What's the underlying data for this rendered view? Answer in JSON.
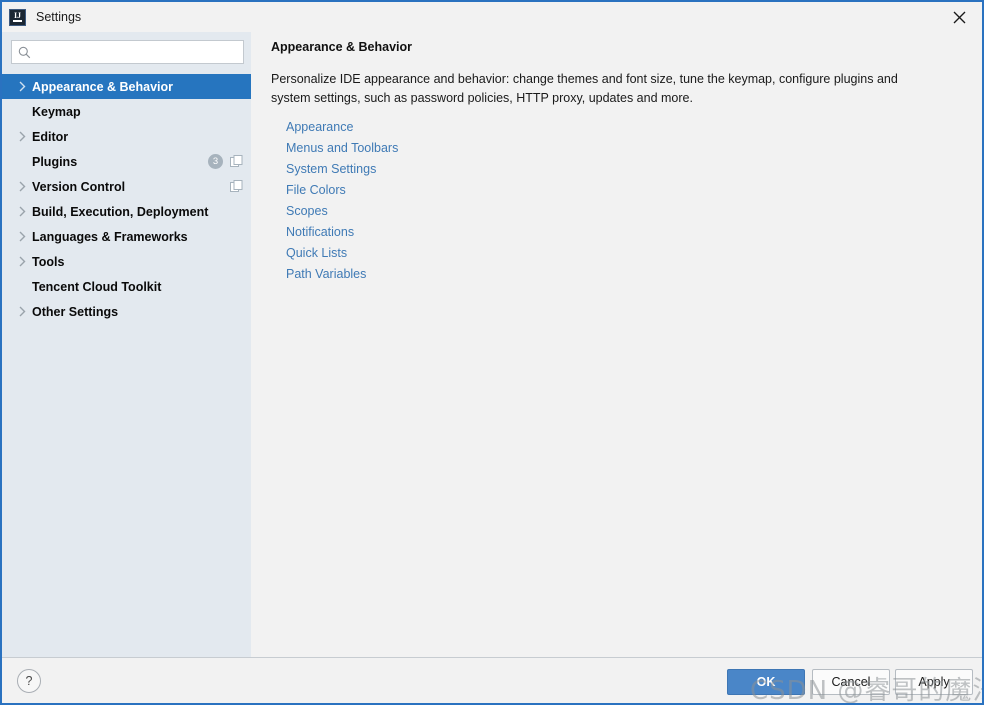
{
  "window": {
    "title": "Settings",
    "logo_icon": "intellij-idea-logo",
    "close_icon": "close-icon",
    "border_color": "#2a72c0"
  },
  "search": {
    "value": "",
    "placeholder": "",
    "icon": "search-icon"
  },
  "sidebar": {
    "background": "#e3e9ef",
    "selected_color": "#2675bf",
    "items": [
      {
        "label": "Appearance & Behavior",
        "expandable": true,
        "selected": true,
        "badge": null,
        "stack_icon": false
      },
      {
        "label": "Keymap",
        "expandable": false,
        "selected": false,
        "badge": null,
        "stack_icon": false
      },
      {
        "label": "Editor",
        "expandable": true,
        "selected": false,
        "badge": null,
        "stack_icon": false
      },
      {
        "label": "Plugins",
        "expandable": false,
        "selected": false,
        "badge": "3",
        "stack_icon": true
      },
      {
        "label": "Version Control",
        "expandable": true,
        "selected": false,
        "badge": null,
        "stack_icon": true
      },
      {
        "label": "Build, Execution, Deployment",
        "expandable": true,
        "selected": false,
        "badge": null,
        "stack_icon": false
      },
      {
        "label": "Languages & Frameworks",
        "expandable": true,
        "selected": false,
        "badge": null,
        "stack_icon": false
      },
      {
        "label": "Tools",
        "expandable": true,
        "selected": false,
        "badge": null,
        "stack_icon": false
      },
      {
        "label": "Tencent Cloud Toolkit",
        "expandable": false,
        "selected": false,
        "badge": null,
        "stack_icon": false
      },
      {
        "label": "Other Settings",
        "expandable": true,
        "selected": false,
        "badge": null,
        "stack_icon": false
      }
    ]
  },
  "content": {
    "title": "Appearance & Behavior",
    "description": "Personalize IDE appearance and behavior: change themes and font size, tune the keymap, configure plugins and system settings, such as password policies, HTTP proxy, updates and more.",
    "link_color": "#3f7ab5",
    "links": [
      "Appearance",
      "Menus and Toolbars",
      "System Settings",
      "File Colors",
      "Scopes",
      "Notifications",
      "Quick Lists",
      "Path Variables"
    ]
  },
  "footer": {
    "help_label": "?",
    "ok_label": "OK",
    "cancel_label": "Cancel",
    "apply_label": "Apply",
    "ok_color": "#4a86c8"
  },
  "watermark": {
    "text": "CSDN @睿哥的魔法书"
  }
}
